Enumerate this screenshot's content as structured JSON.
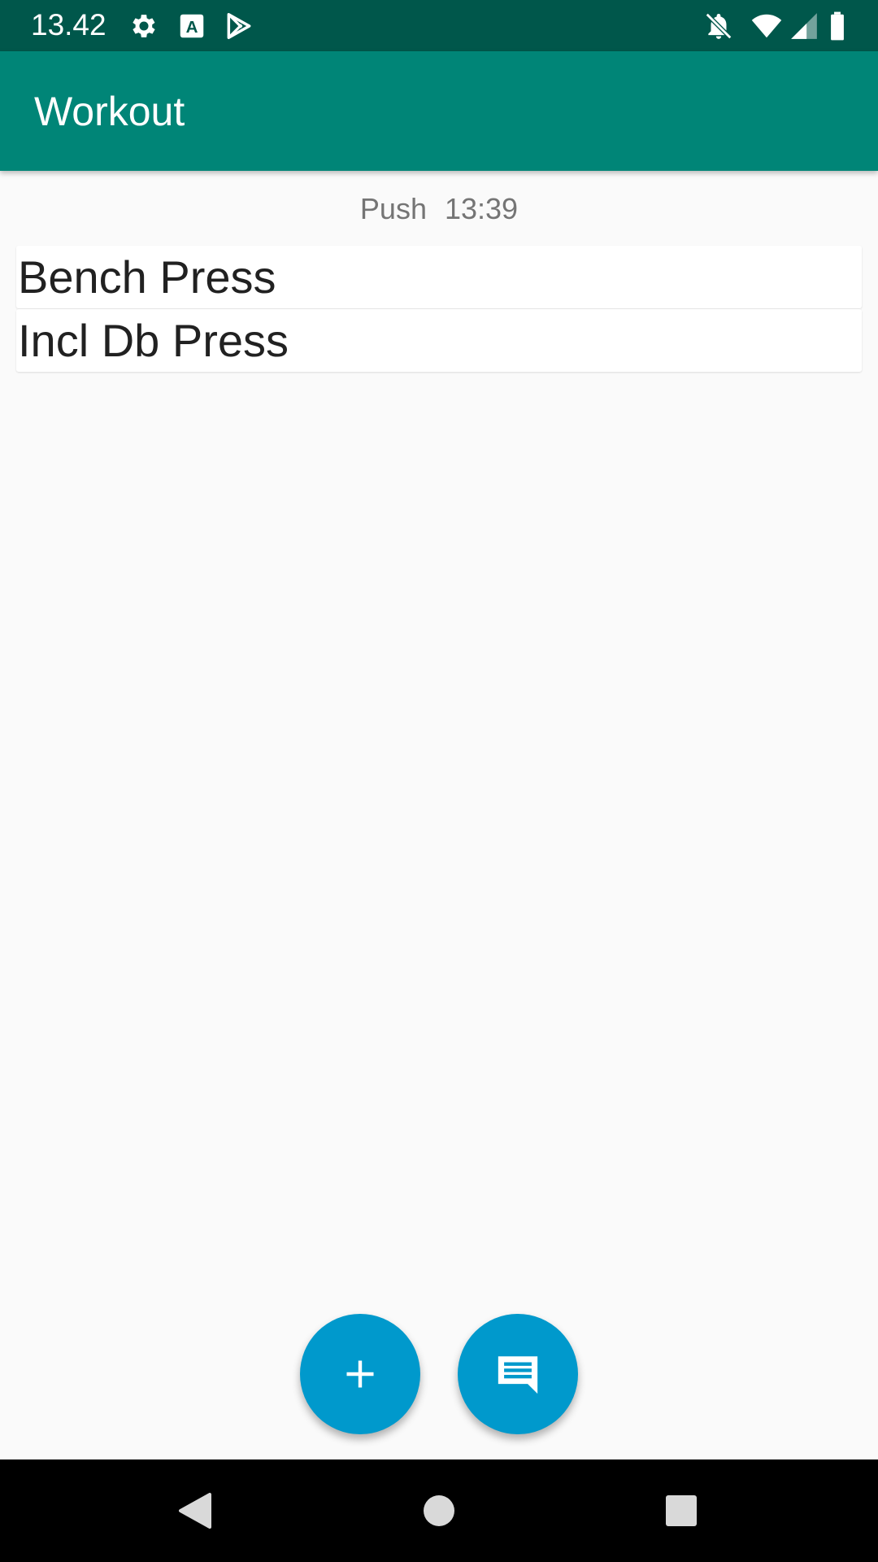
{
  "status_bar": {
    "time": "13.42",
    "icons": [
      "gear-icon",
      "text-a-icon",
      "play-store-icon",
      "notifications-off-icon",
      "wifi-icon",
      "signal-icon",
      "battery-icon"
    ]
  },
  "app_bar": {
    "title": "Workout"
  },
  "session": {
    "name": "Push",
    "time": "13:39"
  },
  "exercises": [
    {
      "name": "Bench Press"
    },
    {
      "name": "Incl Db Press"
    }
  ],
  "fabs": {
    "add_icon": "plus-icon",
    "comment_icon": "comment-icon"
  },
  "nav_bar": {
    "icons": [
      "back-icon",
      "home-icon",
      "recents-icon"
    ]
  },
  "colors": {
    "status_bar": "#00574b",
    "app_bar": "#008577",
    "fab": "#0099cc",
    "background": "#fafafa"
  }
}
